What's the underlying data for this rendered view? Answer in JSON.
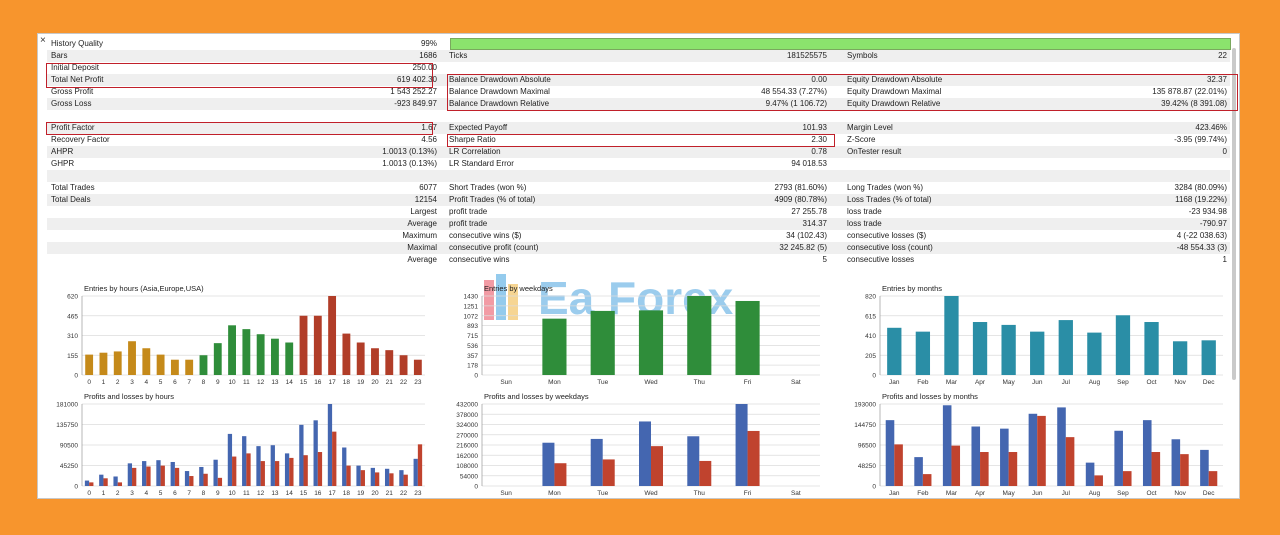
{
  "close_glyph": "×",
  "summary": {
    "hq": {
      "label": "History Quality",
      "value": "99%"
    },
    "rows": [
      [
        {
          "label": "Bars",
          "value": "1686"
        },
        {
          "label": "Ticks",
          "value": "181525575"
        },
        {
          "label": "Symbols",
          "value": "22"
        }
      ],
      [
        {
          "label": "Initial Deposit",
          "value": "250.00"
        },
        {
          "label": "",
          "value": ""
        },
        {
          "label": "",
          "value": ""
        }
      ],
      [
        {
          "label": "Total Net Profit",
          "value": "619 402.30"
        },
        {
          "label": "Balance Drawdown Absolute",
          "value": "0.00"
        },
        {
          "label": "Equity Drawdown Absolute",
          "value": "32.37"
        }
      ],
      [
        {
          "label": "Gross Profit",
          "value": "1 543 252.27"
        },
        {
          "label": "Balance Drawdown Maximal",
          "value": "48 554.33 (7.27%)"
        },
        {
          "label": "Equity Drawdown Maximal",
          "value": "135 878.87 (22.01%)"
        }
      ],
      [
        {
          "label": "Gross Loss",
          "value": "-923 849.97"
        },
        {
          "label": "Balance Drawdown Relative",
          "value": "9.47% (1 106.72)"
        },
        {
          "label": "Equity Drawdown Relative",
          "value": "39.42% (8 391.08)"
        }
      ],
      [
        {
          "label": "",
          "value": ""
        },
        {
          "label": "",
          "value": ""
        },
        {
          "label": "",
          "value": ""
        }
      ],
      [
        {
          "label": "Profit Factor",
          "value": "1.67"
        },
        {
          "label": "Expected Payoff",
          "value": "101.93"
        },
        {
          "label": "Margin Level",
          "value": "423.46%"
        }
      ],
      [
        {
          "label": "Recovery Factor",
          "value": "4.56"
        },
        {
          "label": "Sharpe Ratio",
          "value": "2.30"
        },
        {
          "label": "Z-Score",
          "value": "-3.95 (99.74%)"
        }
      ],
      [
        {
          "label": "AHPR",
          "value": "1.0013 (0.13%)"
        },
        {
          "label": "LR Correlation",
          "value": "0.78"
        },
        {
          "label": "OnTester result",
          "value": "0"
        }
      ],
      [
        {
          "label": "GHPR",
          "value": "1.0013 (0.13%)"
        },
        {
          "label": "LR Standard Error",
          "value": "94 018.53"
        },
        {
          "label": "",
          "value": ""
        }
      ],
      [
        {
          "label": "",
          "value": ""
        },
        {
          "label": "",
          "value": ""
        },
        {
          "label": "",
          "value": ""
        }
      ],
      [
        {
          "label": "Total Trades",
          "value": "6077"
        },
        {
          "label": "Short Trades (won %)",
          "value": "2793 (81.60%)"
        },
        {
          "label": "Long Trades (won %)",
          "value": "3284 (80.09%)"
        }
      ],
      [
        {
          "label": "Total Deals",
          "value": "12154"
        },
        {
          "label": "Profit Trades (% of total)",
          "value": "4909 (80.78%)"
        },
        {
          "label": "Loss Trades (% of total)",
          "value": "1168 (19.22%)"
        }
      ],
      [
        {
          "label": "Largest",
          "value": ""
        },
        {
          "label": "profit trade",
          "value": "27 255.78"
        },
        {
          "label": "loss trade",
          "value": "-23 934.98"
        }
      ],
      [
        {
          "label": "Average",
          "value": ""
        },
        {
          "label": "profit trade",
          "value": "314.37"
        },
        {
          "label": "loss trade",
          "value": "-790.97"
        }
      ],
      [
        {
          "label": "Maximum",
          "value": ""
        },
        {
          "label": "consecutive wins ($)",
          "value": "34 (102.43)"
        },
        {
          "label": "consecutive losses ($)",
          "value": "4 (-22 038.63)"
        }
      ],
      [
        {
          "label": "Maximal",
          "value": ""
        },
        {
          "label": "consecutive profit (count)",
          "value": "32 245.82 (5)"
        },
        {
          "label": "consecutive loss (count)",
          "value": "-48 554.33 (3)"
        }
      ],
      [
        {
          "label": "Average",
          "value": ""
        },
        {
          "label": "consecutive wins",
          "value": "5"
        },
        {
          "label": "consecutive losses",
          "value": "1"
        }
      ]
    ]
  },
  "watermark": {
    "text1": "Ea",
    "text2": "Forex"
  },
  "colors": {
    "orange": "#c58a1a",
    "green": "#2f8d3a",
    "red": "#b13d28",
    "teal": "#2a8ea6",
    "blue": "#4466b0",
    "loss": "#c0432e",
    "hilite": "#c0202a",
    "hq_bar": "#8be36d"
  },
  "chart_data": [
    {
      "type": "bar",
      "title": "Entries by hours (Asia,Europe,USA)",
      "categories": [
        "0",
        "1",
        "2",
        "3",
        "4",
        "5",
        "6",
        "7",
        "8",
        "9",
        "10",
        "11",
        "12",
        "13",
        "14",
        "15",
        "16",
        "17",
        "18",
        "19",
        "20",
        "21",
        "22",
        "23"
      ],
      "values": [
        160,
        175,
        185,
        265,
        210,
        160,
        120,
        120,
        155,
        250,
        390,
        360,
        320,
        285,
        255,
        465,
        465,
        620,
        325,
        255,
        210,
        195,
        155,
        120
      ],
      "yticks": [
        "620",
        "465",
        "310",
        "155",
        "0"
      ],
      "ylim": [
        0,
        620
      ],
      "groups": [
        "orange",
        "orange",
        "orange",
        "orange",
        "orange",
        "orange",
        "orange",
        "orange",
        "green",
        "green",
        "green",
        "green",
        "green",
        "green",
        "green",
        "red",
        "red",
        "red",
        "red",
        "red",
        "red",
        "red",
        "red",
        "red"
      ]
    },
    {
      "type": "bar",
      "title": "Entries by weekdays",
      "categories": [
        "Sun",
        "Mon",
        "Tue",
        "Wed",
        "Thu",
        "Fri",
        "Sat"
      ],
      "values": [
        0,
        1020,
        1160,
        1170,
        1430,
        1340,
        0
      ],
      "yticks": [
        "1430",
        "1251",
        "1072",
        "893",
        "715",
        "536",
        "357",
        "178",
        "0"
      ],
      "ylim": [
        0,
        1430
      ],
      "color": "green"
    },
    {
      "type": "bar",
      "title": "Entries by months",
      "categories": [
        "Jan",
        "Feb",
        "Mar",
        "Apr",
        "May",
        "Jun",
        "Jul",
        "Aug",
        "Sep",
        "Oct",
        "Nov",
        "Dec"
      ],
      "values": [
        490,
        450,
        820,
        550,
        520,
        450,
        570,
        440,
        620,
        550,
        350,
        360
      ],
      "yticks": [
        "820",
        "615",
        "410",
        "205",
        "0"
      ],
      "ylim": [
        0,
        820
      ],
      "color": "teal"
    },
    {
      "type": "bar",
      "title": "Profits and losses by hours",
      "categories": [
        "0",
        "1",
        "2",
        "3",
        "4",
        "5",
        "6",
        "7",
        "8",
        "9",
        "10",
        "11",
        "12",
        "13",
        "14",
        "15",
        "16",
        "17",
        "18",
        "19",
        "20",
        "21",
        "22",
        "23"
      ],
      "yticks": [
        "181000",
        "135750",
        "90500",
        "45250",
        "0"
      ],
      "ylim": [
        0,
        181000
      ],
      "series": [
        {
          "name": "",
          "values": [
            12000,
            25000,
            21000,
            50000,
            55000,
            57000,
            53000,
            33000,
            42000,
            58000,
            115000,
            110000,
            88000,
            90000,
            72000,
            135000,
            145000,
            181000,
            85000,
            45000,
            40000,
            38000,
            35000,
            60000
          ]
        },
        {
          "name": "",
          "values": [
            8000,
            17000,
            8000,
            40000,
            43000,
            45000,
            40000,
            22000,
            27000,
            18000,
            65000,
            72000,
            55000,
            55000,
            62000,
            68000,
            75000,
            120000,
            45000,
            35000,
            30000,
            28000,
            25000,
            92000
          ]
        }
      ]
    },
    {
      "type": "bar",
      "title": "Profits and losses by weekdays",
      "categories": [
        "Sun",
        "Mon",
        "Tue",
        "Wed",
        "Thu",
        "Fri",
        "Sat"
      ],
      "yticks": [
        "432000",
        "378000",
        "324000",
        "270000",
        "216000",
        "162000",
        "108000",
        "54000",
        "0"
      ],
      "ylim": [
        0,
        432000
      ],
      "series": [
        {
          "name": "",
          "values": [
            0,
            228000,
            248000,
            340000,
            262000,
            432000,
            0
          ]
        },
        {
          "name": "",
          "values": [
            0,
            120000,
            140000,
            210000,
            132000,
            290000,
            0
          ]
        }
      ]
    },
    {
      "type": "bar",
      "title": "Profits and losses by months",
      "categories": [
        "Jan",
        "Feb",
        "Mar",
        "Apr",
        "May",
        "Jun",
        "Jul",
        "Aug",
        "Sep",
        "Oct",
        "Nov",
        "Dec"
      ],
      "yticks": [
        "193000",
        "144750",
        "96500",
        "48250",
        "0"
      ],
      "ylim": [
        0,
        193000
      ],
      "series": [
        {
          "name": "",
          "values": [
            155000,
            68000,
            190000,
            140000,
            135000,
            170000,
            185000,
            55000,
            130000,
            155000,
            110000,
            85000
          ]
        },
        {
          "name": "",
          "values": [
            98000,
            28000,
            95000,
            80000,
            80000,
            165000,
            115000,
            25000,
            35000,
            80000,
            75000,
            35000
          ]
        }
      ]
    }
  ]
}
